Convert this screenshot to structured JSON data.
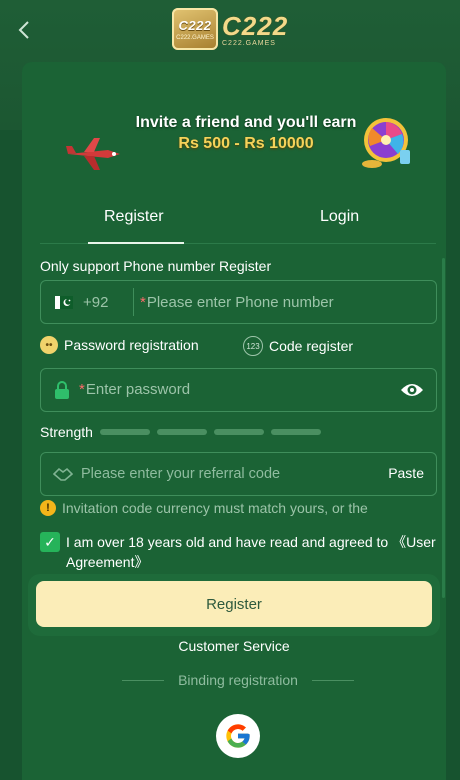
{
  "header": {
    "logo_badge_text": "C222",
    "logo_badge_sub": "C222.GAMES",
    "logo_text": "C222",
    "logo_sub": "C222.GAMES",
    "back_icon": "chevron-left-icon"
  },
  "banner": {
    "line1": "Invite a friend and you'll earn",
    "line2": "Rs 500 - Rs 10000"
  },
  "tabs": {
    "register": "Register",
    "login": "Login",
    "active": "register"
  },
  "form": {
    "hint": "Only support Phone number Register",
    "phone": {
      "prefix": "+92",
      "required_mark": "*",
      "placeholder": "Please enter Phone number"
    },
    "modes": {
      "password": "Password registration",
      "code": "Code register",
      "code_icon_text": "123"
    },
    "password": {
      "required_mark": "*",
      "placeholder": "Enter password"
    },
    "strength_label": "Strength",
    "referral": {
      "placeholder": "Please enter your referral code",
      "paste": "Paste"
    },
    "warning": "Invitation code currency must match yours, or the",
    "agree": "I am over 18 years old and have read and agreed to 《User Agreement》",
    "agree_checked": true,
    "register_button": "Register"
  },
  "footer": {
    "customer_service": "Customer Service",
    "binding": "Binding registration",
    "google_icon": "google-icon"
  },
  "colors": {
    "background": "#17532f",
    "card": "#1b6335",
    "accent_green": "#26b35a",
    "button": "#fbedb8",
    "gold": "#f5d35a"
  }
}
